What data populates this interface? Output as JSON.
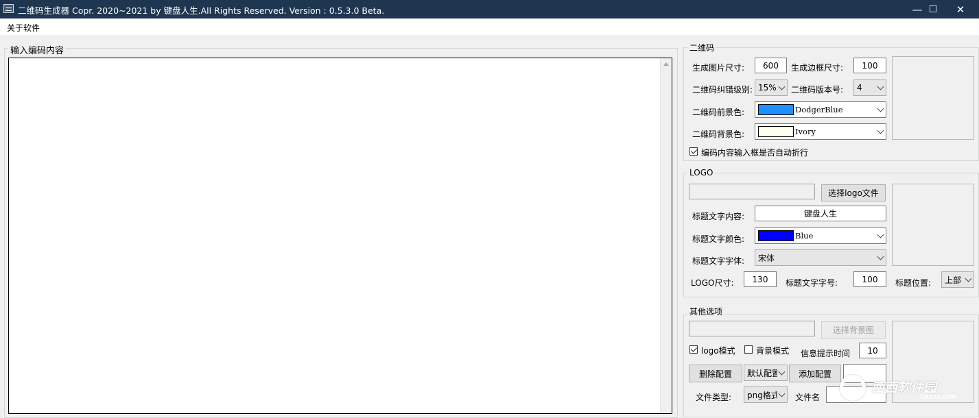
{
  "window": {
    "title": "二维码生成器  Copr. 2020~2021 by 键盘人生.All Rights Reserved.  Version : 0.5.3.0 Beta.",
    "minimize_glyph": "—",
    "maximize_glyph": "☐",
    "close_glyph": "✕"
  },
  "menu": {
    "about": "关于软件"
  },
  "input_panel": {
    "label": "输入编码内容",
    "content": ""
  },
  "qrcode_group": {
    "title": "二维码",
    "image_size_label": "生成图片尺寸:",
    "image_size_value": "600",
    "border_size_label": "生成边框尺寸:",
    "border_size_value": "100",
    "ecc_label": "二维码纠错级别:",
    "ecc_value": "15%",
    "version_label": "二维码版本号:",
    "version_value": "4",
    "fg_label": "二维码前景色:",
    "fg_value": "DodgerBlue",
    "fg_color": "#1e90ff",
    "bg_label": "二维码背景色:",
    "bg_value": "Ivory",
    "bg_color": "#fffff0",
    "wrap_label": "编码内容输入框是否自动折行",
    "wrap_checked": true
  },
  "logo_group": {
    "title": "LOGO",
    "path_value": "",
    "choose_button": "选择logo文件",
    "caption_label": "标题文字内容:",
    "caption_value": "键盘人生",
    "color_label": "标题文字颜色:",
    "color_value": "Blue",
    "color_hex": "#0000ff",
    "font_label": "标题文字字体:",
    "font_value": "宋体",
    "logo_size_label": "LOGO尺寸:",
    "logo_size_value": "130",
    "font_size_label": "标题文字字号:",
    "font_size_value": "100",
    "position_label": "标题位置:",
    "position_value": "上部"
  },
  "other_group": {
    "title": "其他选项",
    "bg_path_value": "",
    "choose_bg_button": "选择背景图",
    "logo_mode_label": "logo模式",
    "logo_mode_checked": true,
    "bg_mode_label": "背景模式",
    "bg_mode_checked": false,
    "tip_time_label": "信息提示时间",
    "tip_time_value": "10",
    "delete_config_button": "删除配置",
    "config_value": "默认配置",
    "add_config_button": "添加配置",
    "file_type_label": "文件类型:",
    "file_type_value": "png格式",
    "file_name_label": "文件名"
  },
  "watermark": {
    "text": "西西软件园",
    "subtext": "CR173.COM"
  }
}
